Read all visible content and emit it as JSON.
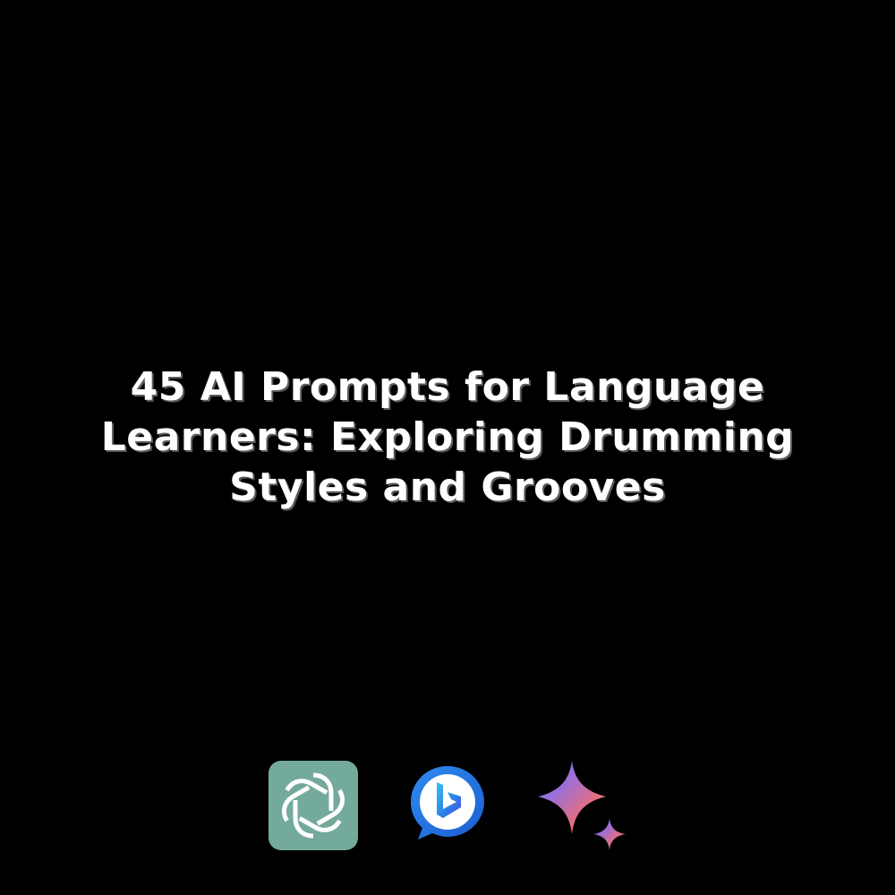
{
  "title_lines": [
    "45 AI Prompts for Language",
    "Learners: Exploring Drumming",
    "Styles and Grooves"
  ],
  "colors": {
    "background": "#000000",
    "title": "#ffffff",
    "chatgpt_tile": "#74aa9c",
    "bing_blue": "#1b6fd9",
    "gemini_gradient": [
      "#4f7ef0",
      "#9b6fd9",
      "#e86f7e",
      "#f5a05a"
    ]
  },
  "icons": [
    "chatgpt-logo-icon",
    "bing-chat-logo-icon",
    "gemini-sparkle-icon"
  ]
}
